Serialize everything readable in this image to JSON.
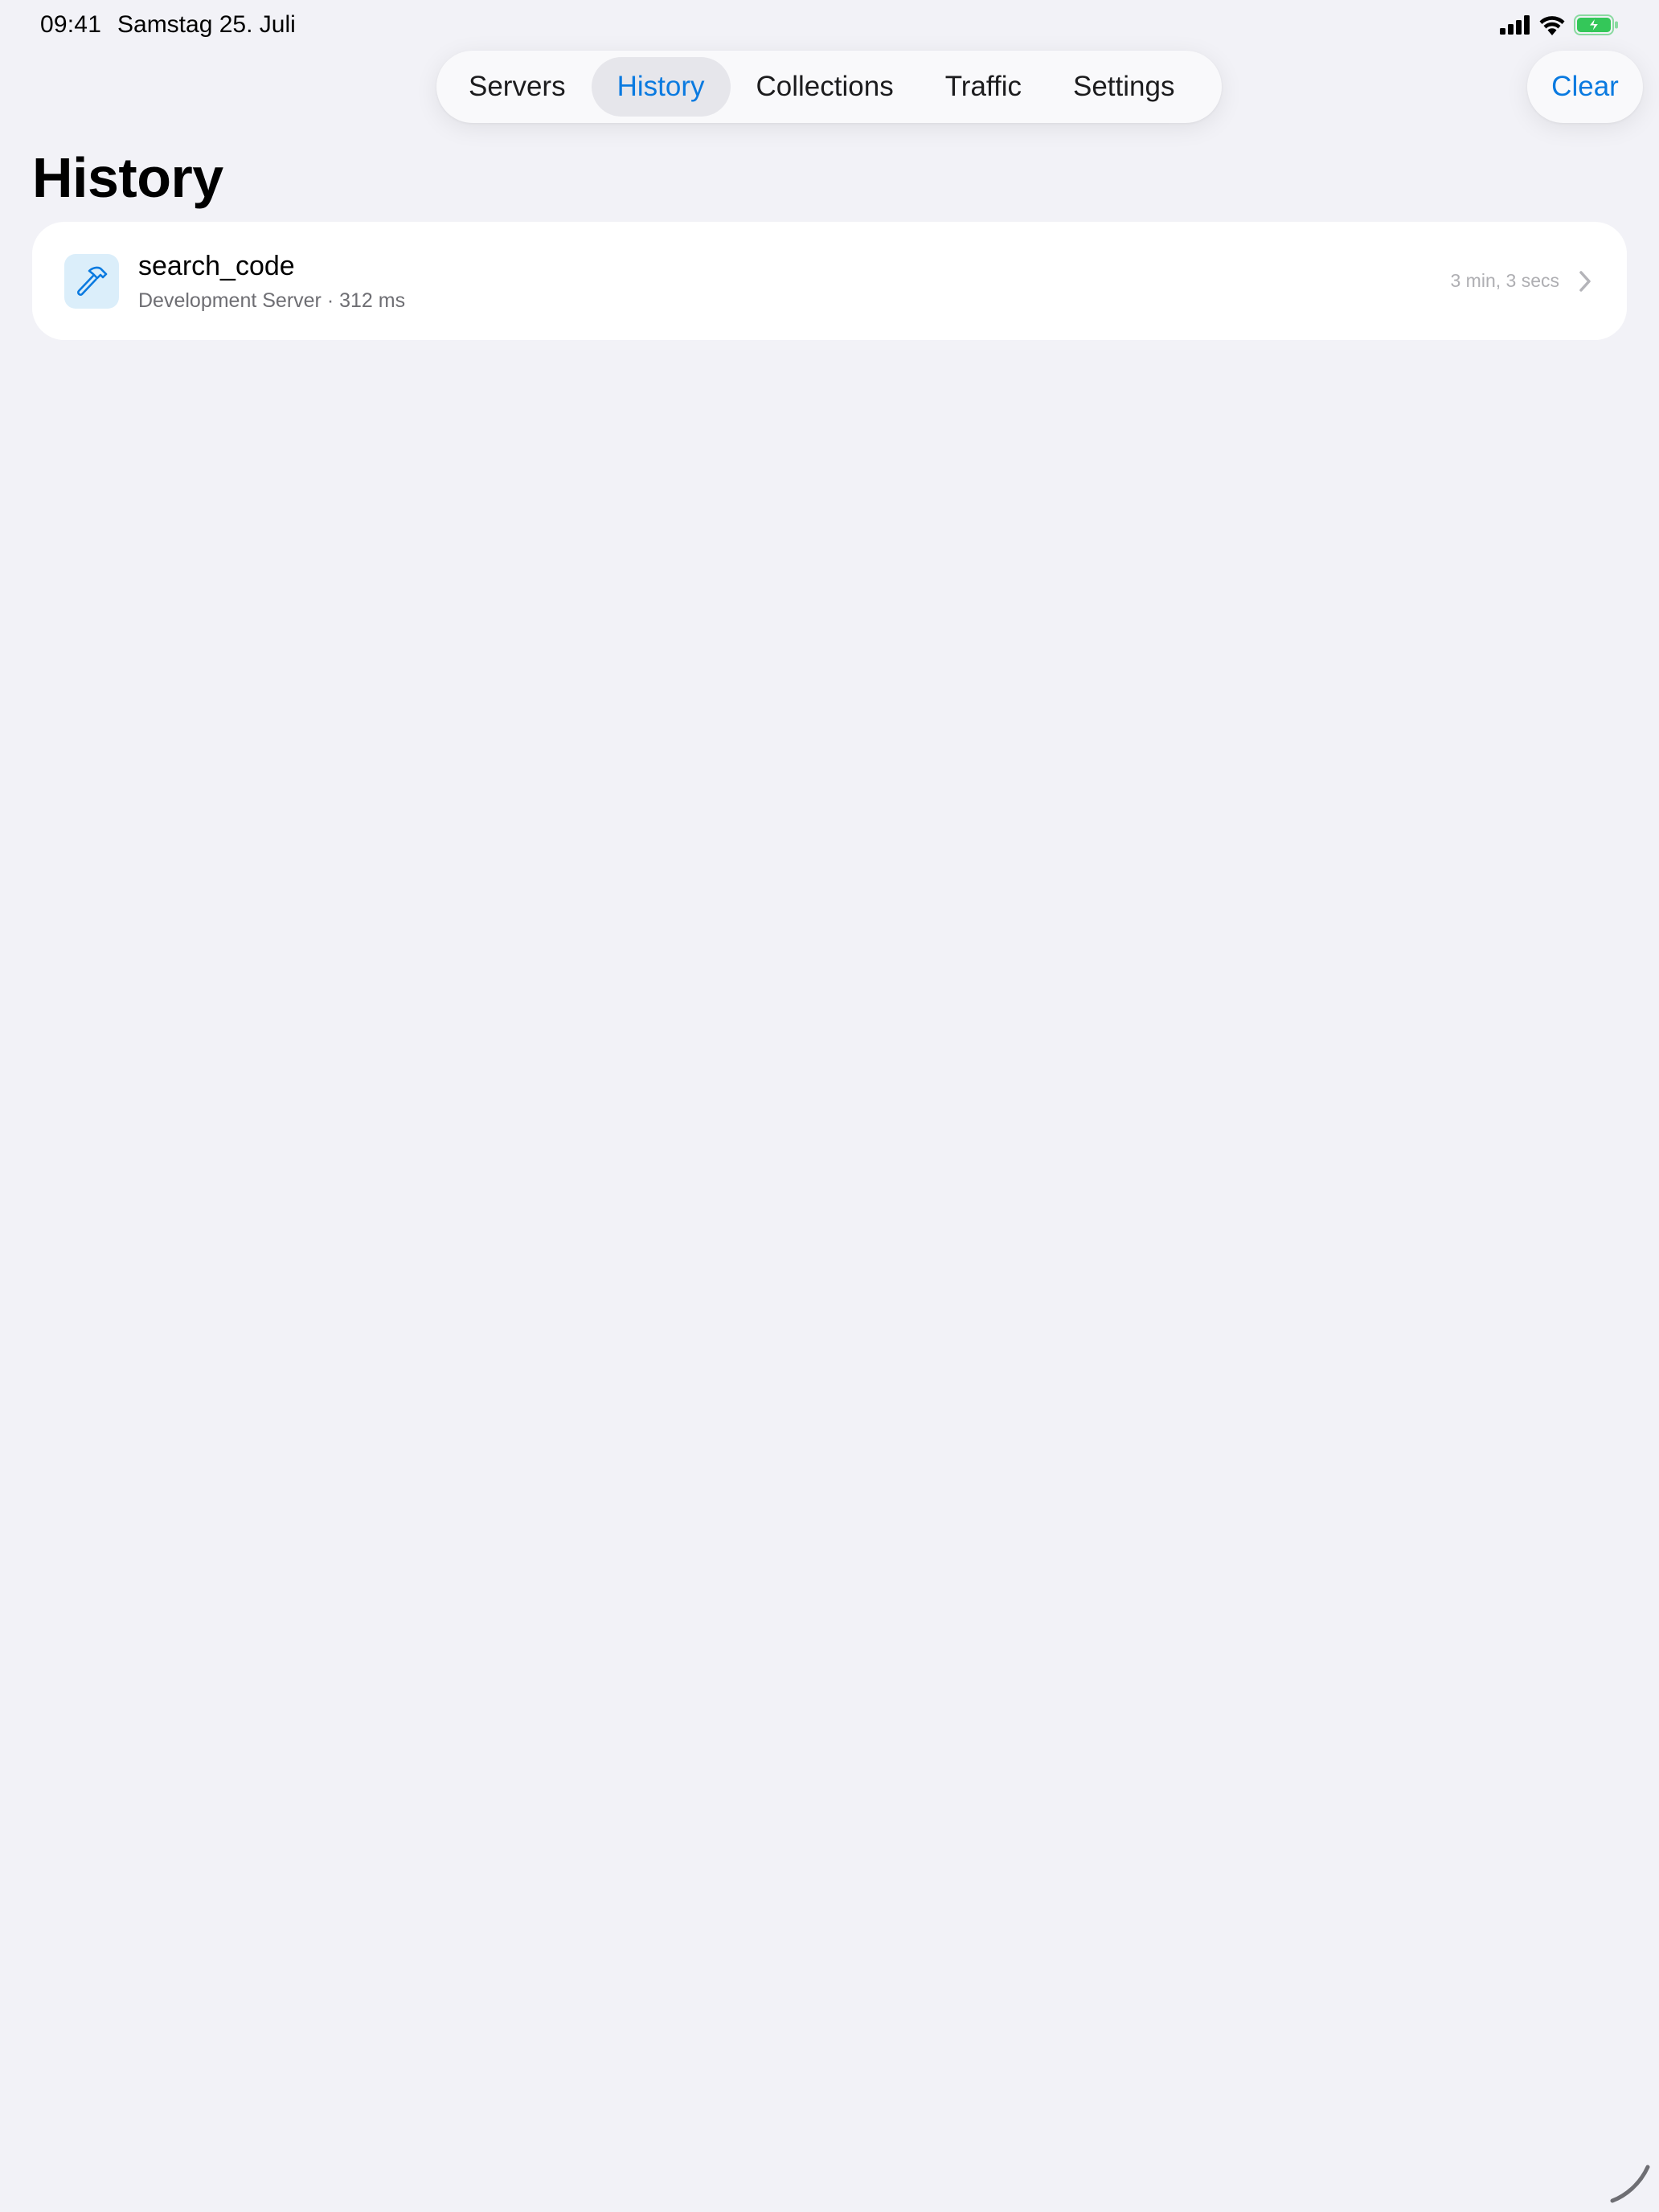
{
  "status_bar": {
    "time": "09:41",
    "date": "Samstag 25. Juli",
    "icons": [
      "cellular-signal-icon",
      "wifi-icon",
      "battery-charging-icon"
    ]
  },
  "tabs": [
    {
      "label": "Servers",
      "active": false
    },
    {
      "label": "History",
      "active": true
    },
    {
      "label": "Collections",
      "active": false
    },
    {
      "label": "Traffic",
      "active": false
    },
    {
      "label": "Settings",
      "active": false
    }
  ],
  "toolbar": {
    "clear_label": "Clear"
  },
  "page": {
    "title": "History"
  },
  "history": {
    "items": [
      {
        "icon": "hammer-icon",
        "title": "search_code",
        "subtitle": "Development Server · 312 ms",
        "time": "3 min, 3 secs"
      }
    ]
  },
  "colors": {
    "accent": "#0a7ae0",
    "background": "#f2f2f7",
    "card": "#ffffff",
    "battery": "#34c759",
    "icon_tint_bg": "#dbeefa"
  }
}
